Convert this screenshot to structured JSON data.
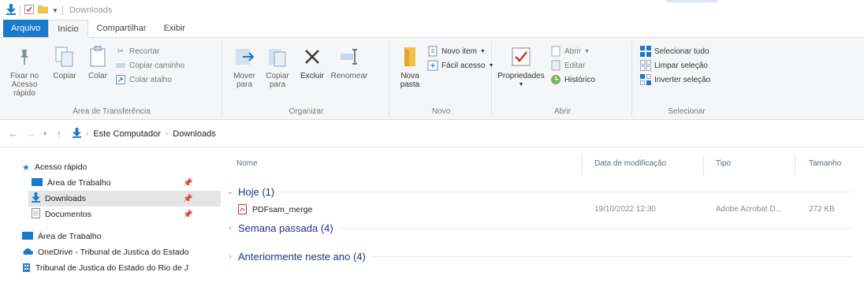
{
  "window": {
    "title": "Downloads"
  },
  "colors": {
    "accent": "#1979ca",
    "group_title": "#1e3287",
    "selected_bg": "#e5e5e5",
    "pdf_red": "#d9302a",
    "folder_yellow": "#f0c14b"
  },
  "ribbon": {
    "tabs": [
      "Arquivo",
      "Início",
      "Compartilhar",
      "Exibir"
    ],
    "groups": {
      "clipboard": {
        "label": "Área de Transferência",
        "pin": "Fixar no Acesso rápido",
        "copy": "Copiar",
        "paste": "Colar",
        "cut": "Recortar",
        "copy_path": "Copiar caminho",
        "paste_shortcut": "Colar atalho"
      },
      "organize": {
        "label": "Organizar",
        "move_to": "Mover para",
        "copy_to": "Copiar para",
        "delete": "Excluir",
        "rename": "Renomear"
      },
      "new": {
        "label": "Novo",
        "new_folder": "Nova pasta",
        "new_item": "Novo item",
        "easy_access": "Fácil acesso"
      },
      "open": {
        "label": "Abrir",
        "properties": "Propriedades",
        "open": "Abrir",
        "edit": "Editar",
        "history": "Histórico"
      },
      "select": {
        "label": "Selecionar",
        "select_all": "Selecionar tudo",
        "clear_selection": "Limpar seleção",
        "invert_selection": "Inverter seleção"
      }
    }
  },
  "address": {
    "breadcrumbs": [
      "Este Computador",
      "Downloads"
    ]
  },
  "nav": {
    "items": [
      {
        "label": "Acesso rápido",
        "icon": "star-icon"
      },
      {
        "label": "Área de Trabalho",
        "icon": "desktop-icon",
        "pin": "📌"
      },
      {
        "label": "Downloads",
        "icon": "download-icon",
        "pin": "📌",
        "selected": true
      },
      {
        "label": "Documentos",
        "icon": "document-icon",
        "pin": "📌"
      },
      {
        "label": "Área de Trabalho",
        "icon": "desktop-icon"
      },
      {
        "label": "OneDrive - Tribunal de Justica do Estado",
        "icon": "cloud-icon"
      },
      {
        "label": "Tribunal de Justica do Estado do Rio de J",
        "icon": "building-icon"
      }
    ]
  },
  "files": {
    "columns": {
      "name": "Nome",
      "date": "Data de modificação",
      "type": "Tipo",
      "size": "Tamanho"
    },
    "groups": [
      {
        "title": "Hoje (1)",
        "expanded": true
      },
      {
        "title": "Semana passada (4)",
        "expanded": false
      },
      {
        "title": "Anteriormente neste ano (4)",
        "expanded": false
      }
    ],
    "rows": [
      {
        "name": "PDFsam_merge",
        "date": "19/10/2022 12:30",
        "type": "Adobe Acrobat D...",
        "size": "272 KB"
      }
    ]
  }
}
